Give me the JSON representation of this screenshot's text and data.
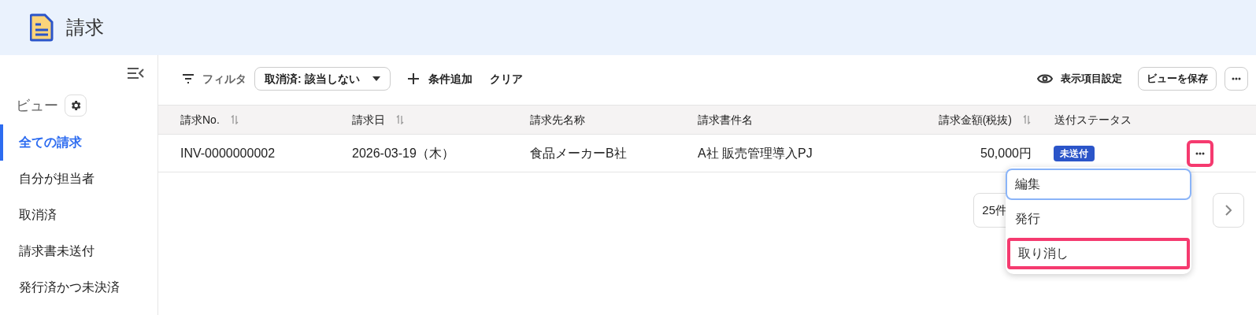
{
  "header": {
    "title": "請求"
  },
  "sidebar": {
    "view_label": "ビュー",
    "items": [
      {
        "label": "全ての請求",
        "selected": true
      },
      {
        "label": "自分が担当者",
        "selected": false
      },
      {
        "label": "取消済",
        "selected": false
      },
      {
        "label": "請求書未送付",
        "selected": false
      },
      {
        "label": "発行済かつ未決済",
        "selected": false
      }
    ]
  },
  "toolbar": {
    "filter_label": "フィルタ",
    "filter_chip": "取消済: 該当しない",
    "add_condition": "条件追加",
    "clear": "クリア",
    "column_settings": "表示項目設定",
    "save_view": "ビューを保存"
  },
  "table": {
    "columns": [
      {
        "label": "請求No.",
        "sortable": true,
        "kind": "text"
      },
      {
        "label": "請求日",
        "sortable": true,
        "kind": "text"
      },
      {
        "label": "請求先名称",
        "sortable": false,
        "kind": "text"
      },
      {
        "label": "請求書件名",
        "sortable": false,
        "kind": "text"
      },
      {
        "label": "請求金額(税抜)",
        "sortable": true,
        "kind": "amount"
      },
      {
        "label": "送付ステータス",
        "sortable": false,
        "kind": "text"
      }
    ],
    "rows": [
      {
        "cells": [
          "INV-0000000002",
          "2026-03-19（木）",
          "食品メーカーB社",
          "A社 販売管理導入PJ",
          "50,000円"
        ],
        "status": "未送付",
        "menu_highlighted": true
      }
    ]
  },
  "pagination": {
    "page_size": "25件"
  },
  "row_menu": {
    "items": [
      {
        "label": "編集",
        "focused": true,
        "highlighted": false
      },
      {
        "label": "発行",
        "focused": false,
        "highlighted": false
      },
      {
        "label": "取り消し",
        "focused": false,
        "highlighted": true
      }
    ]
  }
}
